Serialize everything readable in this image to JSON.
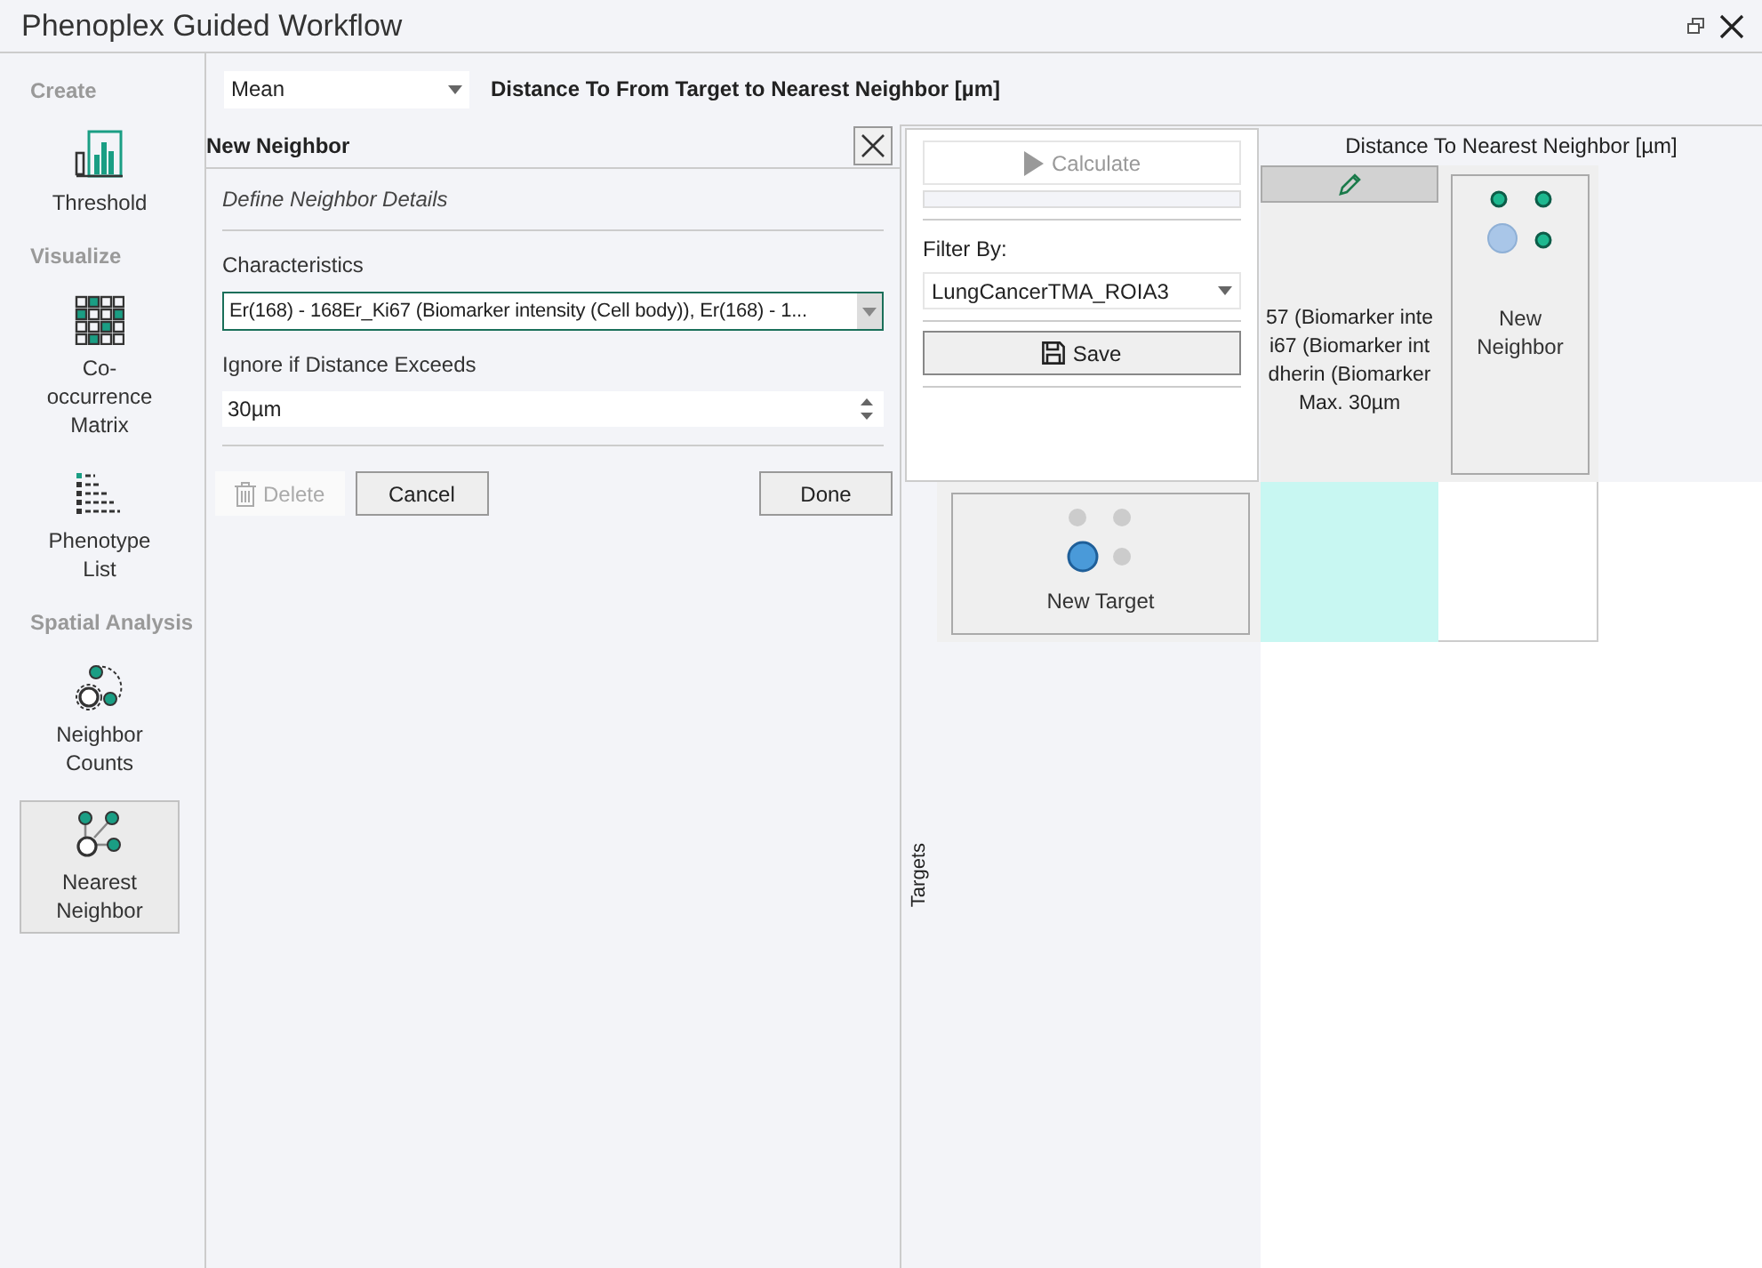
{
  "window": {
    "title": "Phenoplex Guided Workflow"
  },
  "sidebar": {
    "sections": [
      {
        "heading": "Create",
        "items": [
          {
            "label": "Threshold",
            "kind": "threshold",
            "selected": false
          }
        ]
      },
      {
        "heading": "Visualize",
        "items": [
          {
            "label": "Co-occurrence Matrix",
            "kind": "matrix",
            "selected": false
          },
          {
            "label": "Phenotype List",
            "kind": "list",
            "selected": false
          }
        ]
      },
      {
        "heading": "Spatial Analysis",
        "items": [
          {
            "label": "Neighbor Counts",
            "kind": "counts",
            "selected": false
          },
          {
            "label": "Nearest Neighbor",
            "kind": "nearest",
            "selected": true
          }
        ]
      }
    ]
  },
  "toolbar": {
    "statistic": "Mean",
    "title": "Distance To From Target to Nearest Neighbor [µm]"
  },
  "neighbor_panel": {
    "title": "New Neighbor",
    "subtitle": "Define Neighbor Details",
    "characteristics_label": "Characteristics",
    "characteristics_value": "Er(168) - 168Er_Ki67 (Biomarker intensity (Cell body)), Er(168) - 1...",
    "distance_label": "Ignore if Distance Exceeds",
    "distance_value": "30µm",
    "buttons": [
      {
        "label": "Delete",
        "kind": "trash",
        "disabled": true
      },
      {
        "label": "Cancel",
        "kind": "plain",
        "disabled": false
      },
      {
        "label": "Done",
        "kind": "plain",
        "disabled": false
      }
    ]
  },
  "popup": {
    "calculate": {
      "label": "Calculate",
      "disabled": true
    },
    "progress": {
      "level": 0
    },
    "filter_label": "Filter By:",
    "filter_value": "LungCancerTMA_ROIA3",
    "save": "Save"
  },
  "grid": {
    "column_title": "Distance To Nearest Neighbor [µm]",
    "column_lines": [
      "57 (Biomarker inte",
      "i67 (Biomarker int",
      "dherin (Biomarker",
      "Max. 30µm"
    ],
    "new_neighbor": "New Neighbor",
    "row_title": "Targets",
    "new_target": "New Target"
  }
}
